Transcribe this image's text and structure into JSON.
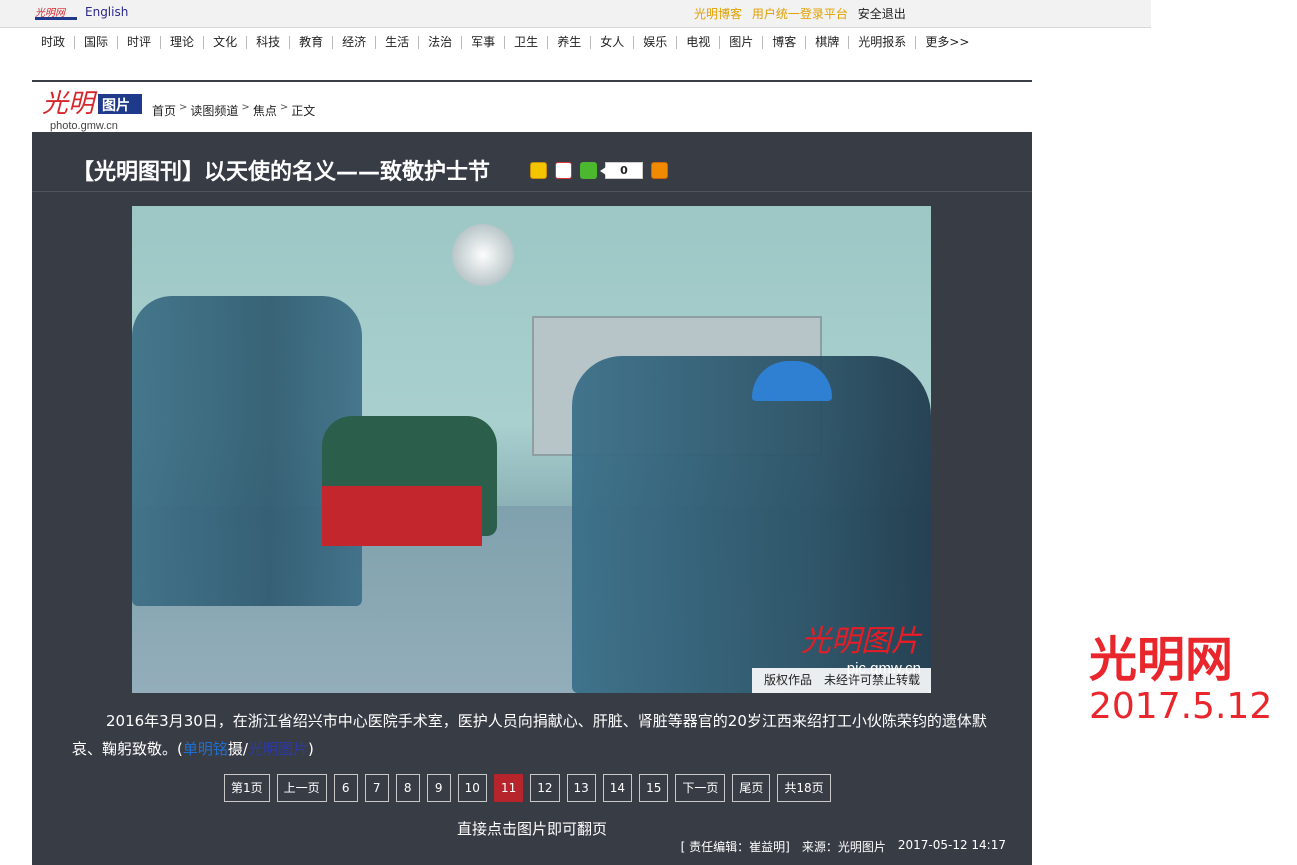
{
  "topbar": {
    "site_logo": "光明网",
    "english": "English",
    "blog_link": "光明博客",
    "login_link": "用户统一登录平台",
    "logout_link": "安全退出"
  },
  "nav": [
    "时政",
    "国际",
    "时评",
    "理论",
    "文化",
    "科技",
    "教育",
    "经济",
    "生活",
    "法治",
    "军事",
    "卫生",
    "养生",
    "女人",
    "娱乐",
    "电视",
    "图片",
    "博客",
    "棋牌",
    "光明报系",
    "更多>>"
  ],
  "channel": {
    "logo_text": "光明图片",
    "logo_url": "photo.gmw.cn",
    "breadcrumb": [
      "首页",
      "读图频道",
      "焦点",
      "正文"
    ]
  },
  "article": {
    "title": "【光明图刊】以天使的名义——致敬护士节",
    "like_count": "0",
    "caption_main": "2016年3月30日，在浙江省绍兴市中心医院手术室，医护人员向捐献心、肝脏、肾脏等器官的20岁江西来绍打工小伙陈荣钧的遗体默哀、鞠躬致敬。(",
    "caption_author": "单明铭",
    "caption_shot": "摄/",
    "caption_credit": "光明图片",
    "caption_end": ")",
    "watermark_logo": "光明图片",
    "watermark_url": "pic.gmw.cn",
    "watermark_note": "版权作品　未经许可禁止转载"
  },
  "pager": {
    "first": "第1页",
    "prev": "上一页",
    "pages": [
      "6",
      "7",
      "8",
      "9",
      "10",
      "11",
      "12",
      "13",
      "14",
      "15"
    ],
    "current": "11",
    "next": "下一页",
    "last": "尾页",
    "total": "共18页"
  },
  "hint": "直接点击图片即可翻页",
  "meta": {
    "editor": "[ 责任编辑：崔益明]",
    "source": "来源：光明图片",
    "date": "2017-05-12 14:17"
  },
  "side": {
    "brand": "光明网",
    "date": "2017.5.12"
  },
  "colors": {
    "main_bg": "#383c45",
    "accent_red": "#b6252c",
    "brand_red": "#e8262c",
    "link_gold": "#e0a000"
  }
}
